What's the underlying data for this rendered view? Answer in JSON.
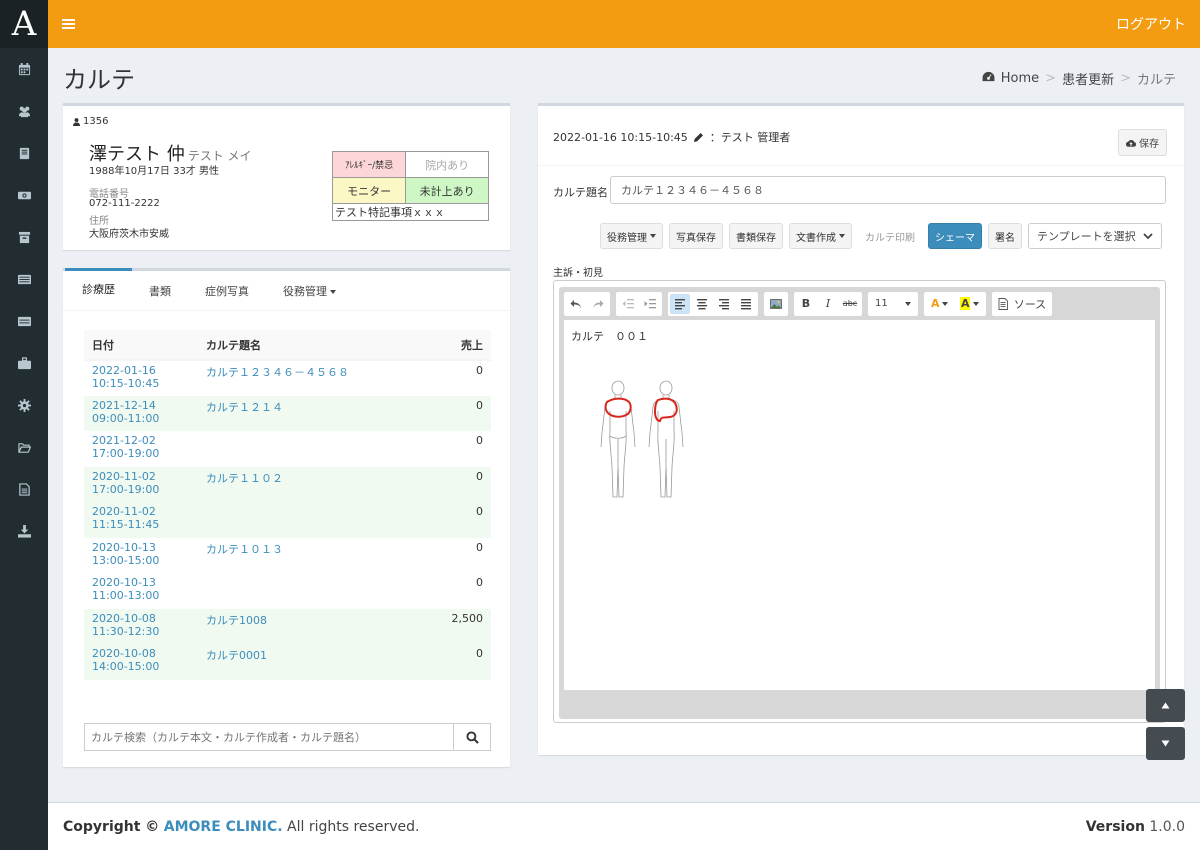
{
  "app": {
    "logo": "A",
    "logout": "ログアウト"
  },
  "page": {
    "title": "カルテ",
    "breadcrumb": [
      "Home",
      "患者更新",
      "カルテ"
    ]
  },
  "patient": {
    "id": "1356",
    "name": "澤テスト 仲",
    "kana": "テスト メイ",
    "birth": "1988年10月17日 33才 男性",
    "phone_label": "電話番号",
    "phone": "072-111-2222",
    "address_label": "住所",
    "address": "大阪府茨木市安威",
    "alerts": {
      "allergy": "ｱﾚﾙｷﾞｰ/禁忌",
      "visit": "院内あり",
      "monitor": "モニター",
      "unbilled": "未計上あり",
      "note": "テスト特記事項ｘｘｘ"
    }
  },
  "history": {
    "tabs": [
      "診療歴",
      "書類",
      "症例写真",
      "役務管理"
    ],
    "headers": [
      "日付",
      "カルテ題名",
      "売上"
    ],
    "rows": [
      {
        "date": "2022-01-16",
        "time": "10:15-10:45",
        "title": "カルテ１２３４６－４５６８",
        "sales": "0"
      },
      {
        "date": "2021-12-14",
        "time": "09:00-11:00",
        "title": "カルテ１２１４",
        "sales": "0"
      },
      {
        "date": "2021-12-02",
        "time": "17:00-19:00",
        "title": "",
        "sales": "0"
      },
      {
        "date": "2020-11-02",
        "time": "17:00-19:00",
        "title": "カルテ１１０２",
        "sales": "0"
      },
      {
        "date": "2020-11-02",
        "time": "11:15-11:45",
        "title": "",
        "sales": "0"
      },
      {
        "date": "2020-10-13",
        "time": "13:00-15:00",
        "title": "カルテ１０１３",
        "sales": "0"
      },
      {
        "date": "2020-10-13",
        "time": "11:00-13:00",
        "title": "",
        "sales": "0"
      },
      {
        "date": "2020-10-08",
        "time": "11:30-12:30",
        "title": "カルテ1008",
        "sales": "2,500"
      },
      {
        "date": "2020-10-08",
        "time": "14:00-15:00",
        "title": "カルテ0001",
        "sales": "0"
      }
    ],
    "search_placeholder": "カルテ検索（カルテ本文・カルテ作成者・カルテ題名）"
  },
  "karte": {
    "header": "2022-01-16 10:15-10:45",
    "author": "：テスト 管理者",
    "save": "保存",
    "title_label": "カルテ題名",
    "title_value": "カルテ１２３４６－４５６８",
    "buttons": {
      "service": "役務管理",
      "photo_save": "写真保存",
      "doc_save": "書類保存",
      "doc_create": "文書作成",
      "print": "カルテ印刷",
      "schema": "シェーマ",
      "sign": "署名"
    },
    "template_placeholder": "テンプレートを選択",
    "chief_label": "主訴・初見",
    "editor": {
      "font_size": "11",
      "source": "ソース",
      "body": "カルテ　００１"
    }
  },
  "footer": {
    "copyright_pre": "Copyright ©",
    "brand": "AMORE CLINIC.",
    "copyright_post": "All rights reserved.",
    "version_label": "Version",
    "version": "1.0.0"
  }
}
